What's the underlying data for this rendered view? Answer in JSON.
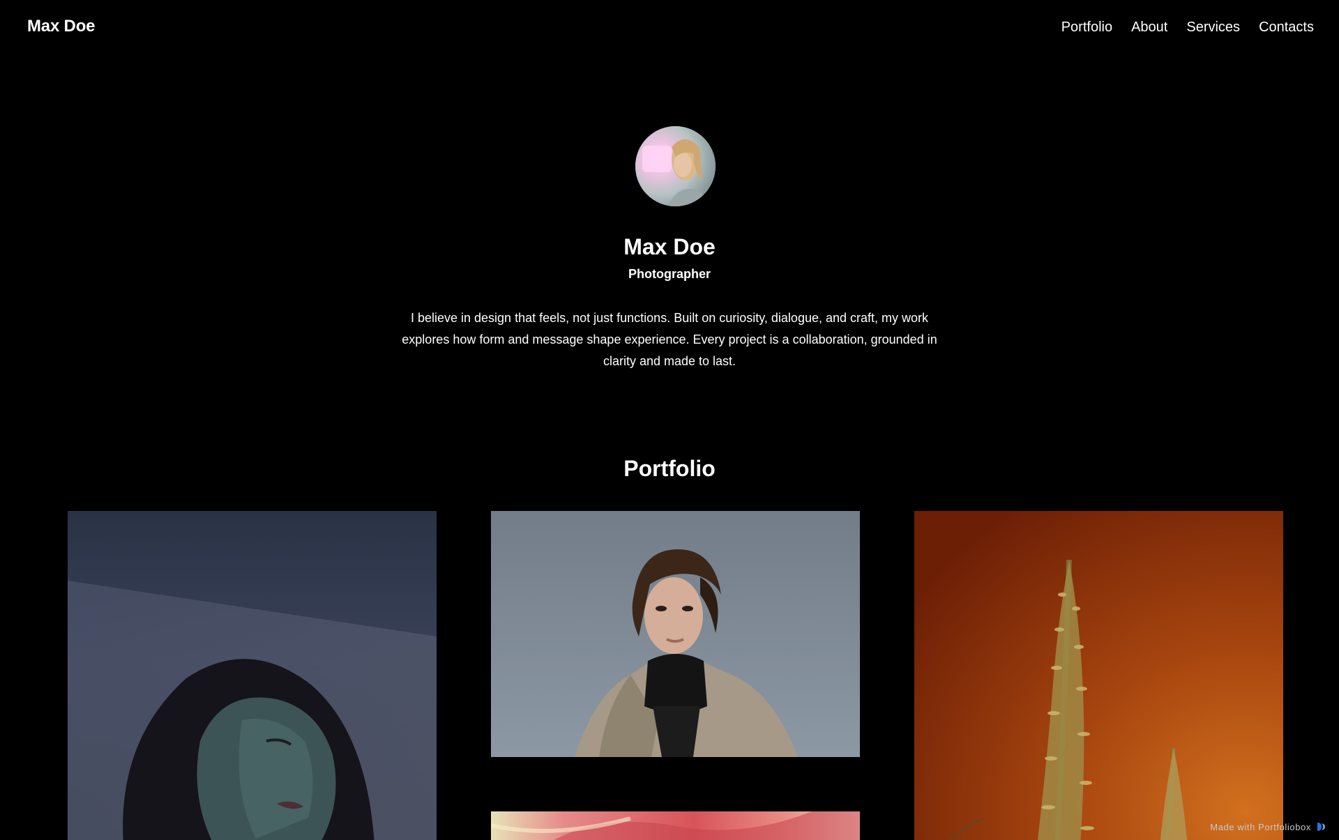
{
  "header": {
    "brand": "Max Doe",
    "nav": [
      {
        "label": "Portfolio"
      },
      {
        "label": "About"
      },
      {
        "label": "Services"
      },
      {
        "label": "Contacts"
      }
    ]
  },
  "hero": {
    "name": "Max Doe",
    "role": "Photographer",
    "bio": "I believe in design that feels, not just functions. Built on curiosity, dialogue, and craft, my work explores how form and message shape experience. Every project is a collaboration, grounded in clarity and made to last."
  },
  "portfolio": {
    "title": "Portfolio",
    "items": [
      {
        "subject": "woman portrait, blue tones"
      },
      {
        "subject": "woman in trench coat, grey sky"
      },
      {
        "subject": "plant stalk, orange background"
      },
      {
        "subject": "pink floral close-up"
      }
    ]
  },
  "footer": {
    "made_with": "Made with Portfoliobox",
    "icon": "portfoliobox-logo-icon"
  },
  "colors": {
    "background": "#000000",
    "text": "#ffffff",
    "badge_text": "#c9c9c9",
    "badge_icon": "#2f6fd6"
  }
}
